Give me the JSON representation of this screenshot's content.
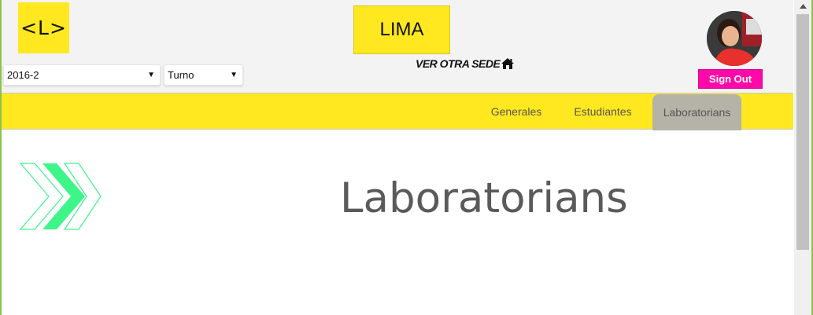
{
  "header": {
    "logo_text": "<L>",
    "period_select": {
      "value": "2016-2",
      "arrow": "▼"
    },
    "turno_select": {
      "value": "Turno",
      "arrow": "▼"
    },
    "sede": "LIMA",
    "other_sede": "VER OTRA SEDE",
    "signout": "Sign Out"
  },
  "nav": {
    "items": [
      {
        "label": "Generales"
      },
      {
        "label": "Estudiantes"
      },
      {
        "label": "Laboratorians",
        "active": true
      }
    ]
  },
  "main": {
    "title": "Laboratorians"
  },
  "colors": {
    "brand_yellow": "#ffe81f",
    "signout_pink": "#ff0aa8",
    "active_tab": "#b5b2a8",
    "chevron_green": "#3ef58a"
  },
  "icons": [
    "home-icon",
    "chevron-down-icon",
    "chevrons-logo-icon",
    "scroll-up-icon"
  ]
}
